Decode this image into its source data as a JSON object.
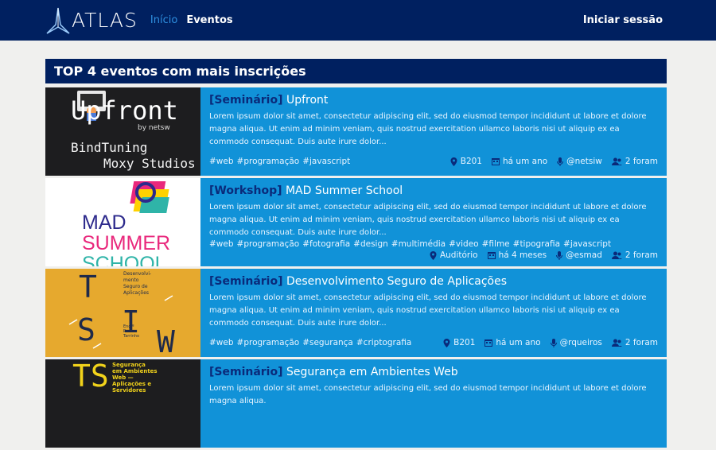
{
  "nav": {
    "brand": "ATLAS",
    "links": [
      {
        "label": "Início",
        "active": true
      },
      {
        "label": "Eventos",
        "active": false
      }
    ],
    "login": "Iniciar sessão"
  },
  "section": {
    "title": "TOP 4 eventos com mais inscrições"
  },
  "events": [
    {
      "type": "[Seminário]",
      "title": "Upfront",
      "description": "Lorem ipsum dolor sit amet, consectetur adipiscing elit, sed do eiusmod tempor incididunt ut labore et dolore magna aliqua. Ut enim ad minim veniam, quis nostrud exercitation ullamco laboris nisi ut aliquip ex ea commodo consequat. Duis aute irure dolor...",
      "tags": [
        "#web",
        "#programação",
        "#javascript"
      ],
      "location": "B201",
      "time": "há um ano",
      "speaker": "@netsiw",
      "attendees": "2 foram",
      "poster": {
        "line1": "Upfront",
        "line2": "by netsw",
        "line3": "BindTuning",
        "line4": "Moxy Studios"
      }
    },
    {
      "type": "[Workshop]",
      "title": "MAD Summer School",
      "description": "Lorem ipsum dolor sit amet, consectetur adipiscing elit, sed do eiusmod tempor incididunt ut labore et dolore magna aliqua. Ut enim ad minim veniam, quis nostrud exercitation ullamco laboris nisi ut aliquip ex ea commodo consequat. Duis aute irure dolor...",
      "tags": [
        "#web",
        "#programação",
        "#fotografia",
        "#design",
        "#multimédia",
        "#video",
        "#filme",
        "#tipografia",
        "#javascript"
      ],
      "location": "Auditório",
      "time": "há 4 meses",
      "speaker": "@esmad",
      "attendees": "2 foram",
      "poster": {
        "line1": "MAD",
        "line2": "SUMMER",
        "line3": "SCHOOL"
      }
    },
    {
      "type": "[Seminário]",
      "title": "Desenvolvimento Seguro de Aplicações",
      "description": "Lorem ipsum dolor sit amet, consectetur adipiscing elit, sed do eiusmod tempor incididunt ut labore et dolore magna aliqua. Ut enim ad minim veniam, quis nostrud exercitation ullamco laboris nisi ut aliquip ex ea commodo consequat. Duis aute irure dolor...",
      "tags": [
        "#web",
        "#programação",
        "#segurança",
        "#criptografia"
      ],
      "location": "B201",
      "time": "há um ano",
      "speaker": "@rqueiros",
      "attendees": "2 foram",
      "poster": {
        "big": "TSIW",
        "caption1": "Desenvolvi-",
        "caption2": "mento",
        "caption3": "Seguro de",
        "caption4": "Aplicações",
        "author1": "Eng.º",
        "author2": "Pedro",
        "author3": "Tarrinho"
      }
    },
    {
      "type": "[Seminário]",
      "title": "Segurança em Ambientes Web",
      "description": "Lorem ipsum dolor sit amet, consectetur adipiscing elit, sed do eiusmod tempor incididunt ut labore et dolore magna aliqua.",
      "tags": [],
      "location": "",
      "time": "",
      "speaker": "",
      "attendees": "",
      "poster": {
        "big": "TS",
        "caption1": "Segurança",
        "caption2": "em Ambientes",
        "caption3": "Web —",
        "caption4": "Aplicações e",
        "caption5": "Servidores"
      }
    }
  ],
  "colors": {
    "navbar": "#002060",
    "card": "#1192d8",
    "type": "#0a2a7a",
    "active_link": "#2e8fe0"
  }
}
